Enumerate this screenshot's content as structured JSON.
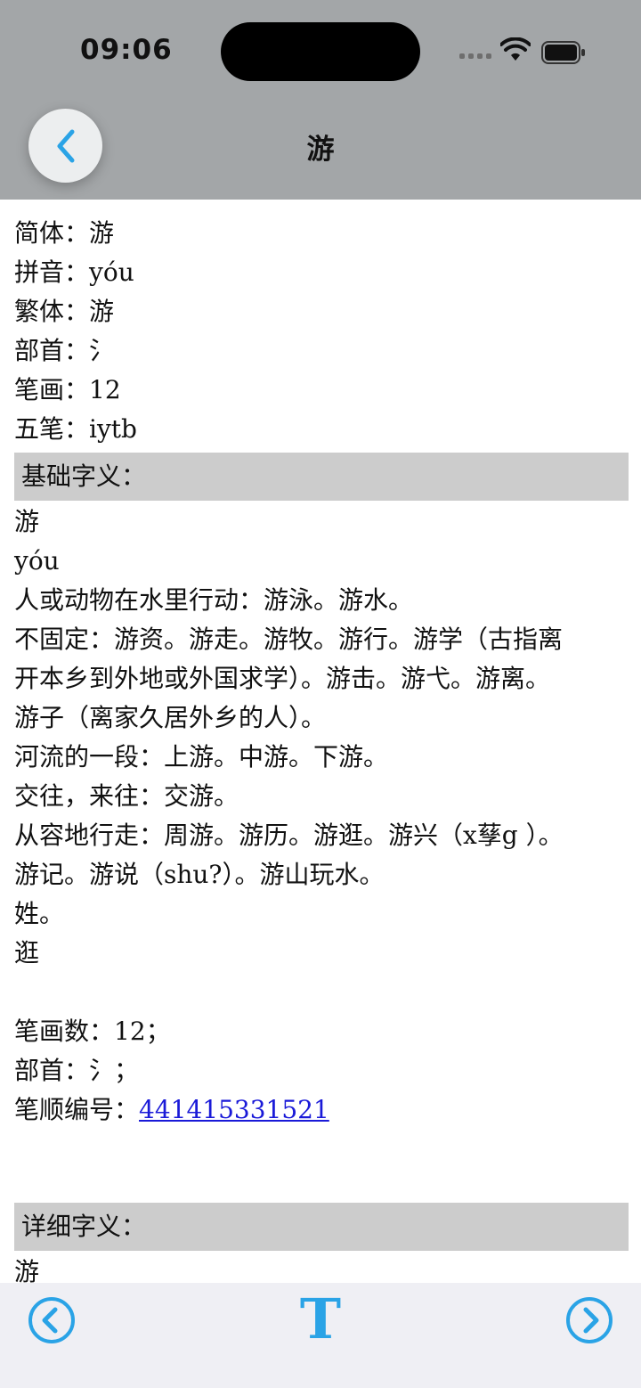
{
  "status_bar": {
    "time": "09:06"
  },
  "nav": {
    "title": "游"
  },
  "info": [
    {
      "label": "简体：",
      "value": "游"
    },
    {
      "label": "拼音：",
      "value": "yóu"
    },
    {
      "label": "繁体：",
      "value": "游"
    },
    {
      "label": "部首：",
      "value": "氵"
    },
    {
      "label": "笔画：",
      "value": "12"
    },
    {
      "label": "五笔：",
      "value": "iytb"
    }
  ],
  "basic": {
    "heading": "基础字义：",
    "lines": [
      "游",
      "yóu",
      "人或动物在水里行动：游泳。游水。",
      "不固定：游资。游走。游牧。游行。游学（古指离",
      "开本乡到外地或外国求学）。游击。游弋。游离。",
      "游子（离家久居外乡的人）。",
      "河流的一段：上游。中游。下游。",
      "交往，来往：交游。",
      "从容地行走：周游。游历。游逛。游兴（x孶g ）。",
      "游记。游说（shu?）。游山玩水。",
      "姓。",
      "逛"
    ],
    "stroke_count": "笔画数：12；",
    "radical": "部首：氵；",
    "stroke_order_label": "笔顺编号：",
    "stroke_order_value": "441415331521"
  },
  "detail": {
    "heading": "详细字义：",
    "first_line": "游"
  },
  "toolbar": {
    "text_button": "T"
  },
  "colors": {
    "accent": "#2aa3e6",
    "topbar": "#a3a6a8",
    "section_bg": "#cccccc",
    "link": "#1a1ad8"
  }
}
